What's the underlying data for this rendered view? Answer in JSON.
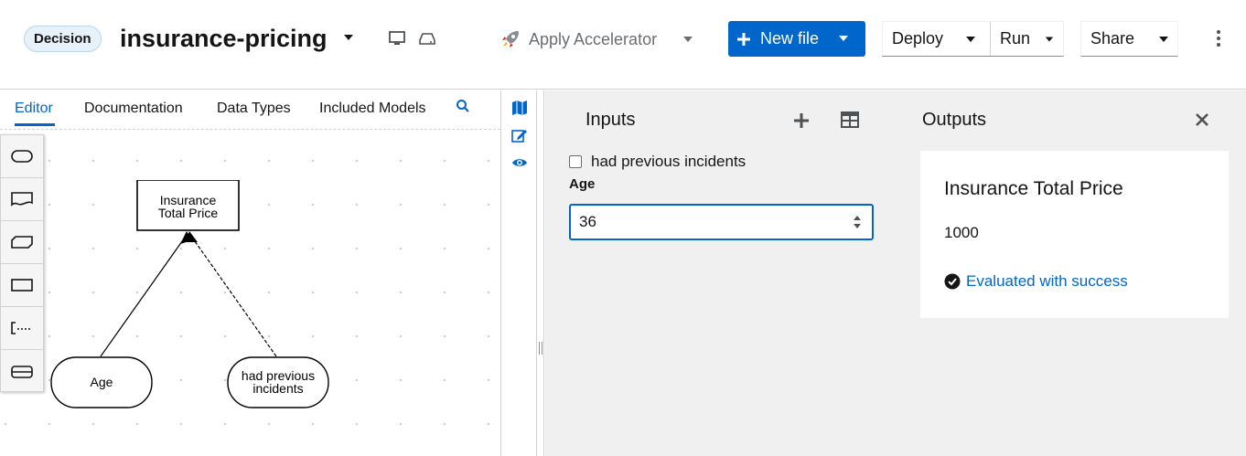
{
  "header": {
    "badge": "Decision",
    "file_name": "insurance-pricing",
    "accelerator_label": "Apply Accelerator",
    "new_file_label": "New file",
    "deploy_label": "Deploy",
    "run_label": "Run",
    "share_label": "Share",
    "icons": {
      "accelerator": "rocket-icon",
      "new_file": "plus-icon",
      "preview": "monitor-icon",
      "device": "hard-drive-icon",
      "more": "kebab-icon"
    }
  },
  "editor": {
    "tabs": [
      {
        "label": "Editor",
        "active": true
      },
      {
        "label": "Documentation",
        "active": false
      },
      {
        "label": "Data Types",
        "active": false
      },
      {
        "label": "Included Models",
        "active": false
      }
    ],
    "palette": [
      "input-data-icon",
      "knowledge-source-icon",
      "business-knowledge-model-icon",
      "decision-icon",
      "text-annotation-icon",
      "decision-service-icon"
    ],
    "nodes": {
      "decision": "Insurance\nTotal Price",
      "input_age": "Age",
      "input_incidents": "had previous\nincidents"
    }
  },
  "side_strip": [
    "map-icon",
    "edit-icon",
    "eye-icon"
  ],
  "inputs": {
    "title": "Inputs",
    "checkbox_label": "had previous incidents",
    "checkbox_checked": false,
    "age_label": "Age",
    "age_value": "36"
  },
  "outputs": {
    "title": "Outputs",
    "result_name": "Insurance Total Price",
    "result_value": "1000",
    "status": "Evaluated with success"
  },
  "colors": {
    "accent": "#0066cc",
    "panel_bg": "#f0f0f0",
    "badge_bg": "#e7f1fa"
  }
}
